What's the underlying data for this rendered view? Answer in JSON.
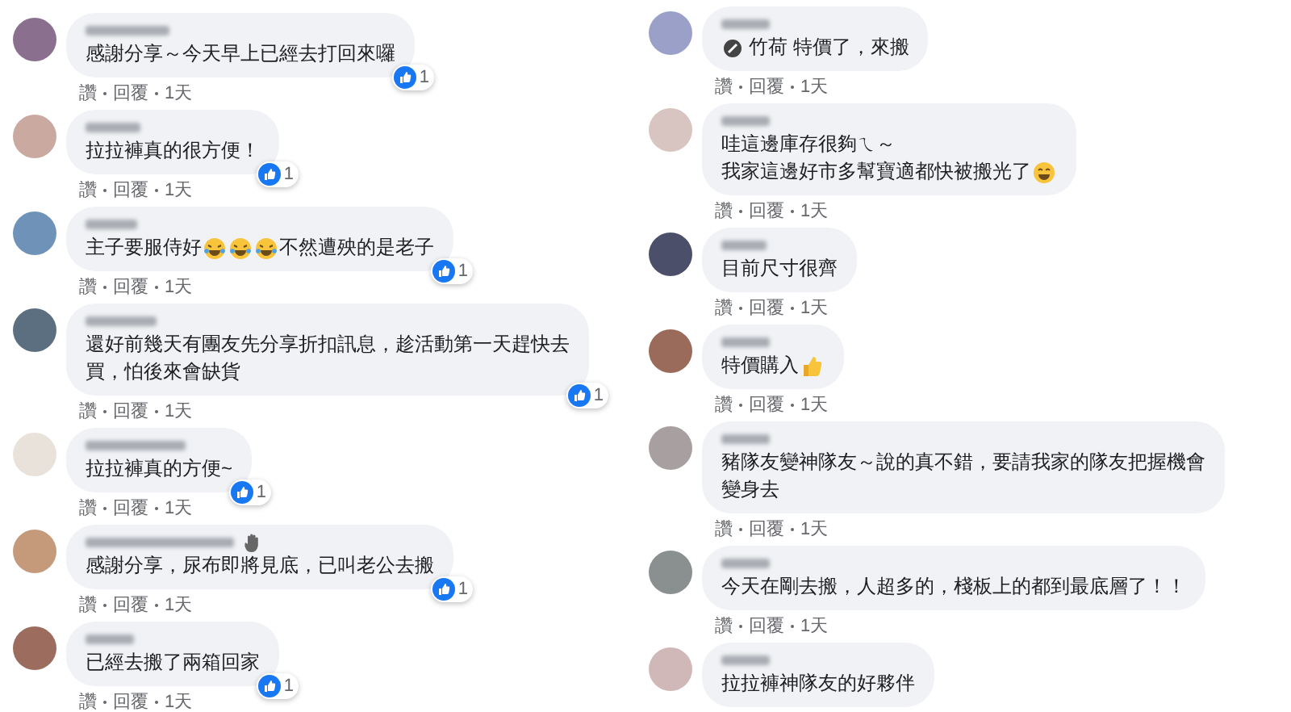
{
  "columns": [
    {
      "comments": [
        {
          "lines": [
            "感謝分享～今天早上已經去打回來囉"
          ],
          "reaction": {
            "count": "1"
          },
          "meta": {
            "actions": [
              "讚",
              "回覆"
            ],
            "time": "1天"
          }
        },
        {
          "lines": [
            "拉拉褲真的很方便！"
          ],
          "reaction": {
            "count": "1"
          },
          "meta": {
            "actions": [
              "讚",
              "回覆"
            ],
            "time": "1天"
          }
        },
        {
          "lines": [
            [
              {
                "kind": "text",
                "text": "主子要服侍好"
              },
              {
                "kind": "laugh"
              },
              {
                "kind": "laugh"
              },
              {
                "kind": "laugh"
              },
              {
                "kind": "text",
                "text": "不然遭殃的是老子"
              }
            ]
          ],
          "reaction": {
            "count": "1"
          },
          "meta": {
            "actions": [
              "讚",
              "回覆"
            ],
            "time": "1天"
          }
        },
        {
          "lines": [
            "還好前幾天有團友先分享折扣訊息，趁活動第一天趕快去",
            "買，怕後來會缺貨"
          ],
          "reaction": {
            "count": "1"
          },
          "meta": {
            "actions": [
              "讚",
              "回覆"
            ],
            "time": "1天"
          }
        },
        {
          "lines": [
            "拉拉褲真的方便~"
          ],
          "reaction": {
            "count": "1"
          },
          "meta": {
            "actions": [
              "讚",
              "回覆"
            ],
            "time": "1天"
          }
        },
        {
          "lines": [
            "感謝分享，尿布即將見底，已叫老公去搬"
          ],
          "badge": true,
          "reaction": {
            "count": "1"
          },
          "meta": {
            "actions": [
              "讚",
              "回覆"
            ],
            "time": "1天"
          }
        },
        {
          "lines": [
            "已經去搬了兩箱回家"
          ],
          "reaction": {
            "count": "1"
          },
          "meta": {
            "actions": [
              "讚",
              "回覆"
            ],
            "time": "1天"
          }
        }
      ]
    },
    {
      "comments": [
        {
          "lines": [
            [
              {
                "kind": "tag"
              },
              {
                "kind": "mention",
                "text": "竹荷"
              },
              {
                "kind": "text",
                "text": " 特價了，來搬"
              }
            ]
          ],
          "meta": {
            "actions": [
              "讚",
              "回覆"
            ],
            "time": "1天"
          }
        },
        {
          "lines": [
            "哇這邊庫存很夠ㄟ～",
            [
              {
                "kind": "text",
                "text": "我家這邊好市多幫寶適都快被搬光了"
              },
              {
                "kind": "grin"
              }
            ]
          ],
          "meta": {
            "actions": [
              "讚",
              "回覆"
            ],
            "time": "1天"
          }
        },
        {
          "lines": [
            "目前尺寸很齊"
          ],
          "meta": {
            "actions": [
              "讚",
              "回覆"
            ],
            "time": "1天"
          }
        },
        {
          "lines": [
            [
              {
                "kind": "text",
                "text": "特價購入"
              },
              {
                "kind": "thumb"
              }
            ]
          ],
          "meta": {
            "actions": [
              "讚",
              "回覆"
            ],
            "time": "1天"
          }
        },
        {
          "lines": [
            "豬隊友變神隊友～說的真不錯，要請我家的隊友把握機會",
            "變身去"
          ],
          "meta": {
            "actions": [
              "讚",
              "回覆"
            ],
            "time": "1天"
          }
        },
        {
          "lines": [
            "今天在剛去搬，人超多的，棧板上的都到最底層了！！"
          ],
          "meta": {
            "actions": [
              "讚",
              "回覆"
            ],
            "time": "1天"
          }
        },
        {
          "lines": [
            "拉拉褲神隊友的好夥伴"
          ]
        }
      ]
    }
  ]
}
